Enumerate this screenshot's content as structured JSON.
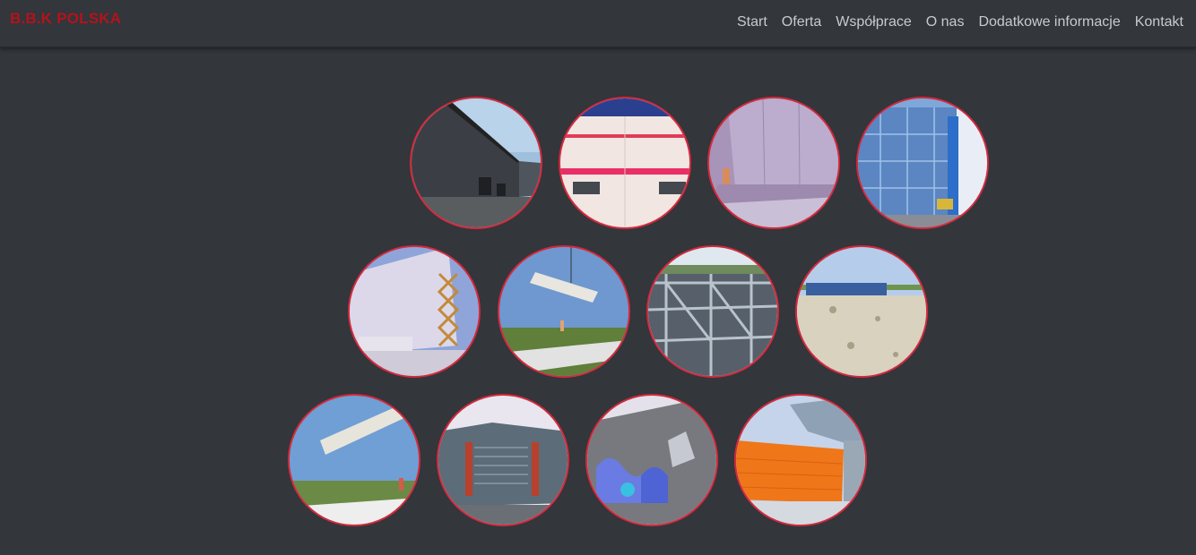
{
  "brand": "B.B.K POLSKA",
  "nav": [
    {
      "label": "Start"
    },
    {
      "label": "Oferta"
    },
    {
      "label": "Współprace"
    },
    {
      "label": "O nas"
    },
    {
      "label": "Dodatkowe informacje"
    },
    {
      "label": "Kontakt"
    }
  ],
  "gallery": {
    "row_count": 3,
    "items_per_row": 4,
    "border_color": "#d8283c",
    "photos": [
      {
        "subject": "dark-cladded-warehouse-facade"
      },
      {
        "subject": "white-panel-wall-with-red-stripe"
      },
      {
        "subject": "worker-installing-wall-panels"
      },
      {
        "subject": "blue-high-bay-racking-structure"
      },
      {
        "subject": "white-wall-with-scissor-lift"
      },
      {
        "subject": "crane-lifting-panel"
      },
      {
        "subject": "steel-frame-roof-construction"
      },
      {
        "subject": "flat-roof-with-workers"
      },
      {
        "subject": "crane-lifting-panel-over-field"
      },
      {
        "subject": "modern-building-with-louvres"
      },
      {
        "subject": "graffiti-on-grey-wall"
      },
      {
        "subject": "orange-panel-facade"
      }
    ]
  }
}
